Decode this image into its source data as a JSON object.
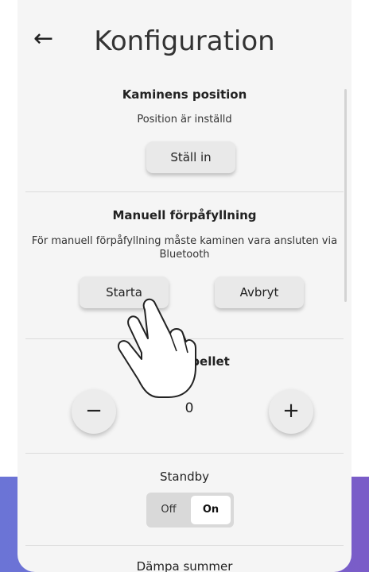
{
  "header": {
    "back_label": "←",
    "title": "Konfiguration"
  },
  "stove_position": {
    "title": "Kaminens position",
    "status": "Position är inställd",
    "button": "Ställ in"
  },
  "manual_prefill": {
    "title": "Manuell förpåfyllning",
    "description": "För manuell förpåfyllning måste kaminen vara ansluten via Bluetooth",
    "start_button": "Starta",
    "cancel_button": "Avbryt"
  },
  "pellet_type": {
    "title_partial": "Typ av pellet",
    "title_visible": "av pellet",
    "decrement": "−",
    "value": "0",
    "increment": "+"
  },
  "standby": {
    "title": "Standby",
    "off_label": "Off",
    "on_label": "On",
    "selected": "On"
  },
  "buzzer": {
    "title": "Dämpa summer"
  },
  "icons": {
    "back": "arrow-left-icon",
    "pointer": "tap-hand-icon"
  }
}
